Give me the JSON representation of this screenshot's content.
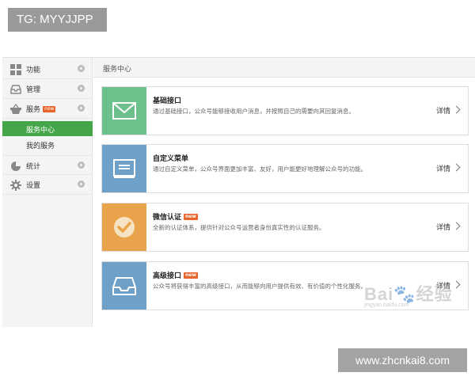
{
  "overlay": {
    "tg_label": "TG: MYYJJPP",
    "site_watermark": "www.zhcnkai8.com"
  },
  "baidu_watermark": {
    "logo_text": "Bai",
    "logo_cn": "经验",
    "url": "jingyan.baidu.com"
  },
  "sidebar": {
    "items": [
      {
        "label": "功能",
        "icon": "grid-icon"
      },
      {
        "label": "管理",
        "icon": "inbox-icon"
      },
      {
        "label": "服务",
        "icon": "basket-icon",
        "badge": "new"
      },
      {
        "label": "统计",
        "icon": "pie-chart-icon"
      },
      {
        "label": "设置",
        "icon": "gear-icon"
      }
    ],
    "sub_items": [
      {
        "label": "服务中心",
        "active": true
      },
      {
        "label": "我的服务",
        "active": false
      }
    ]
  },
  "main": {
    "header": "服务中心",
    "cards": [
      {
        "title": "基础接口",
        "desc": "通过基础接口，公众号能够接收用户消息，并按照自己的需要向其回复消息。",
        "detail": "详情",
        "icon": "envelope-icon",
        "color": "#6cc08b"
      },
      {
        "title": "自定义菜单",
        "desc": "通过自定义菜单，公众号界面更加丰富、友好，用户能更好地理解公众号的功能。",
        "detail": "详情",
        "icon": "menu-screen-icon",
        "color": "#6fa0c8"
      },
      {
        "title": "微信认证",
        "badge": "new",
        "desc": "全新的认证体系，提供针对公众号运营者身份真实性的认证服务。",
        "detail": "详情",
        "icon": "checkmark-icon",
        "color": "#e9a34a"
      },
      {
        "title": "高级接口",
        "badge": "new",
        "desc": "公众号将获得丰富的高级接口，从而能够向用户提供有效、有价值的个性化服务。",
        "detail": "详情",
        "icon": "tray-icon",
        "color": "#6fa0c8"
      }
    ]
  },
  "colors": {
    "accent_green": "#44a649",
    "new_badge": "#e8642c"
  }
}
